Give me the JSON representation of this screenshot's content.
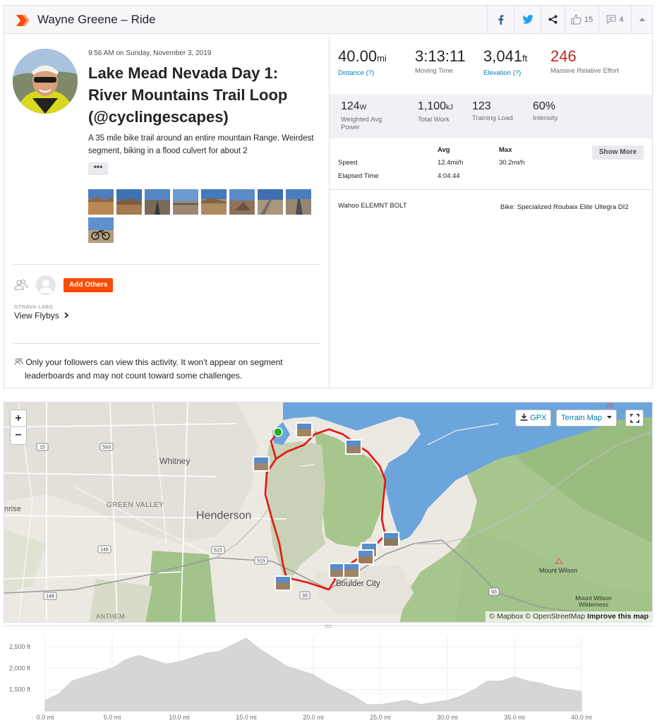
{
  "header": {
    "title": "Wayne Greene – Ride",
    "kudos_count": "15",
    "comment_count": "4"
  },
  "activity": {
    "timestamp": "9:56 AM on Sunday, November 3, 2019",
    "title": "Lake Mead Nevada Day 1: River Mountains Trail Loop (@cyclingescapes)",
    "description": "A 35 mile bike trail around an entire mountain Range. Weirdest segment, biking in a flood culvert for about 2",
    "more_label": "•••",
    "photo_count": 9
  },
  "social": {
    "add_others_label": "Add Others",
    "labs_label": "STRAVA LABS",
    "flybys_label": "View Flybys",
    "privacy_line1": "Only your followers can view this activity. It won't appear on segment",
    "privacy_line2": "leaderboards and may not count toward some challenges."
  },
  "stats": {
    "distance": {
      "value": "40.00",
      "unit": "mi",
      "label": "Distance (?)"
    },
    "moving_time": {
      "value": "3:13:11",
      "label": "Moving Time"
    },
    "elevation": {
      "value": "3,041",
      "unit": "ft",
      "label": "Elevation (?)"
    },
    "relative_effort": {
      "value": "246",
      "label": "Massive Relative Effort"
    },
    "weighted_power": {
      "value": "124",
      "unit": "W",
      "label": "Weighted Avg Power"
    },
    "total_work": {
      "value": "1,100",
      "unit": "kJ",
      "label": "Total Work"
    },
    "training_load": {
      "value": "123",
      "label": "Training Load"
    },
    "intensity": {
      "value": "60%",
      "label": "Intensity"
    }
  },
  "details": {
    "col_avg": "Avg",
    "col_max": "Max",
    "show_more_label": "Show More",
    "speed_label": "Speed",
    "speed_avg": "12.4mi/h",
    "speed_max": "30.2mi/h",
    "elapsed_label": "Elapsed Time",
    "elapsed_avg": "4:04:44",
    "device": "Wahoo ELEMNT BOLT",
    "bike": "Bike: Specialized Roubaix Elite Ultegra DI2"
  },
  "map": {
    "zoom_in": "+",
    "zoom_out": "−",
    "gpx_label": "GPX",
    "terrain_label": "Terrain Map",
    "attribution": "© Mapbox © OpenStreetMap",
    "improve_label": "Improve this map",
    "places": {
      "whitney": "Whitney",
      "green_valley": "GREEN VALLEY",
      "henderson": "Henderson",
      "boulder_city": "Boulder City",
      "mount_wilson": "Mount Wilson",
      "mount_wilson_wilderness": "Mount Wilson Wilderness",
      "anthem": "ANTHEM",
      "sunrise": "nrise"
    },
    "routes": [
      "15",
      "593",
      "146",
      "515",
      "515",
      "148",
      "93",
      "93"
    ]
  },
  "chart_data": {
    "type": "area",
    "xlabel": "",
    "ylabel": "",
    "x_ticks": [
      "0.0 mi",
      "5.0 mi",
      "10.0 mi",
      "15.0 mi",
      "20.0 mi",
      "25.0 mi",
      "30.0 mi",
      "35.0 mi",
      "40.0 mi"
    ],
    "y_ticks": [
      "2,500 ft",
      "2,000 ft",
      "1,500 ft"
    ],
    "xlim": [
      0,
      40
    ],
    "ylim": [
      1000,
      2750
    ],
    "grid": true,
    "series": [
      {
        "x": [
          0,
          1,
          2,
          3,
          4,
          5,
          6,
          7,
          8,
          9,
          10,
          11,
          12,
          13,
          14,
          15,
          16,
          17,
          18,
          19,
          20,
          21,
          22,
          23,
          24,
          25,
          26,
          27,
          28,
          29,
          30,
          31,
          32,
          33,
          34,
          35,
          36,
          37,
          38,
          39,
          40
        ],
        "values": [
          1250,
          1400,
          1700,
          1800,
          1900,
          2000,
          2200,
          2300,
          2200,
          2100,
          2150,
          2250,
          2350,
          2400,
          2550,
          2700,
          2450,
          2250,
          2050,
          1950,
          1850,
          1650,
          1500,
          1350,
          1150,
          1150,
          1200,
          1250,
          1150,
          1200,
          1250,
          1350,
          1500,
          1700,
          1700,
          1800,
          1700,
          1650,
          1550,
          1500,
          1450
        ]
      }
    ]
  }
}
